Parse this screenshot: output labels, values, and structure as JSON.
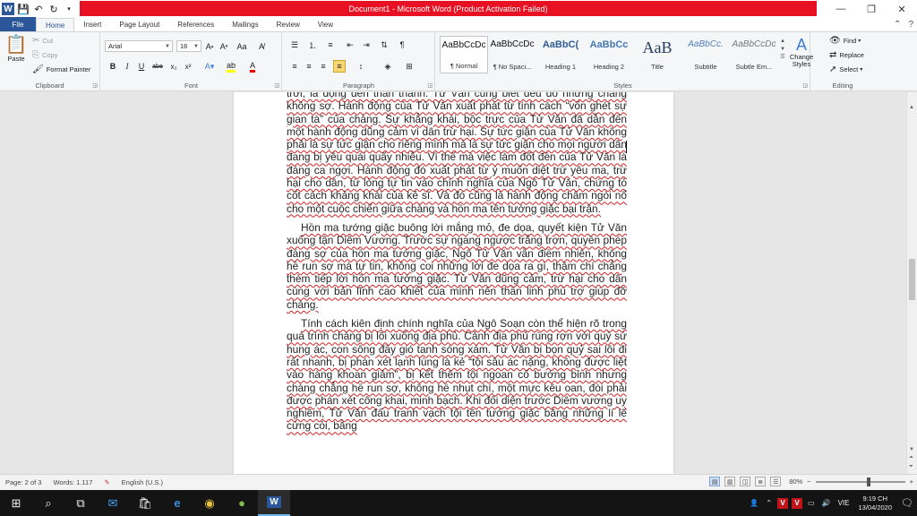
{
  "window": {
    "title": "Document1 - Microsoft Word (Product Activation Failed)",
    "accent_color": "#2b579a",
    "alert_color": "#e81123"
  },
  "tabs": [
    "File",
    "Home",
    "Insert",
    "Page Layout",
    "References",
    "Mailings",
    "Review",
    "View"
  ],
  "active_tab": "Home",
  "clipboard": {
    "paste": "Paste",
    "cut": "Cut",
    "copy": "Copy",
    "format_painter": "Format Painter",
    "label": "Clipboard"
  },
  "font": {
    "name": "Arial",
    "size": "16",
    "label": "Font",
    "buttons": [
      "B",
      "I",
      "U",
      "abe",
      "x₂",
      "x²"
    ]
  },
  "paragraph": {
    "label": "Paragraph"
  },
  "styles": {
    "label": "Styles",
    "items": [
      {
        "preview": "AaBbCcDc",
        "name": "¶ Normal"
      },
      {
        "preview": "AaBbCcDc",
        "name": "¶ No Spaci..."
      },
      {
        "preview": "AaBbC(",
        "name": "Heading 1"
      },
      {
        "preview": "AaBbCc",
        "name": "Heading 2"
      },
      {
        "preview": "AaB",
        "name": "Title"
      },
      {
        "preview": "AaBbCc.",
        "name": "Subtitle"
      },
      {
        "preview": "AaBbCcDc",
        "name": "Subtle Em..."
      }
    ],
    "change_styles": "Change Styles"
  },
  "editing": {
    "label": "Editing",
    "find": "Find",
    "replace": "Replace",
    "select": "Select"
  },
  "document": {
    "paragraphs": [
      "trời, là động đến thần thánh. Tử Văn cũng biết đều đó nhưng chàng không sợ. Hành động của Tử Văn xuất phát từ tính cách “vốn ghét sự gian tà” của chàng. Sự khẳng khái, bộc trực của Tử Văn đã dẫn đến một hành động dũng cảm vì dân trừ hại. Sự tức giận của Tử Văn không phải là sự tức giận cho riêng mình mà là sự tức giận cho mọi người dân đang bị yêu quái quấy nhiễu. Vì thế mà việc làm đốt đền của Tử Văn là đáng ca ngợi. Hành động đó xuất phát từ ý muốn diệt trừ yêu ma, trừ hại cho dân, từ lòng tự tin vào chính nghĩa của Ngô Tử Văn, chứng tỏ cốt cách khảng khái của kẻ sĩ. Và đó cũng là hành động châm ngòi nổ cho một cuộc chiến giữa chàng và hồn ma tên tướng giặc bại trận.",
      "Hồn ma tướng giặc buông lời mắng mỏ, đe dọa, quyết kiện Tử Văn xuống tận Diêm Vương. Trước sự ngang ngược trắng trợn, quyền phép đáng sợ của hồn ma tướng giặc, Ngô Tử Văn vẫn điềm nhiên, không hề run sợ mà tự tin, không coi những lời đe dọa ra gì, thậm chí chẳng thèm tiếp lời hồn ma tướng giặc. Tử Văn dũng cảm, trừ hại cho dân cùng với bản lĩnh cao khiết của mình nên thần linh phù trợ giúp đỡ chàng.",
      "Tính cách kiên định chính nghĩa của Ngô Soạn còn thể hiện rõ trong quá trình chàng bị lôi xuống địa phủ. Cảnh địa phủ rùng rợn với quỷ sứ hung ác, con sông đầy gió tanh sóng xám. Tử Văn bị bọn quỷ sai lôi đi rất nhanh, bị phán xét lạnh lùng là kẻ “tội sâu ác nặng, không được liệt vào hàng khoan giảm”, bị kết thêm tội ngoan cố bướng bỉnh nhưng chàng chẳng hề run sợ, không hề nhụt chí, một mực kêu oan, đòi phải được phán xét công khai, minh bạch. Khi đối diện trước Diêm vương uy nghiêm, Tử Văn đấu tranh vạch tội tên tướng giặc bằng những lí lẽ cứng cỏi, bằng"
    ]
  },
  "status": {
    "page": "Page: 2 of 3",
    "words": "Words: 1.117",
    "language": "English (U.S.)",
    "zoom": "80%",
    "zoom_minus": "−",
    "zoom_plus": "+"
  },
  "taskbar": {
    "icons": [
      "windows-icon",
      "search-icon",
      "task-view-icon",
      "mail-icon",
      "store-icon",
      "edge-icon",
      "chrome-icon",
      "app-icon",
      "word-icon"
    ],
    "ime": "VIE",
    "time": "9:19 CH",
    "date": "13/04/2020"
  }
}
